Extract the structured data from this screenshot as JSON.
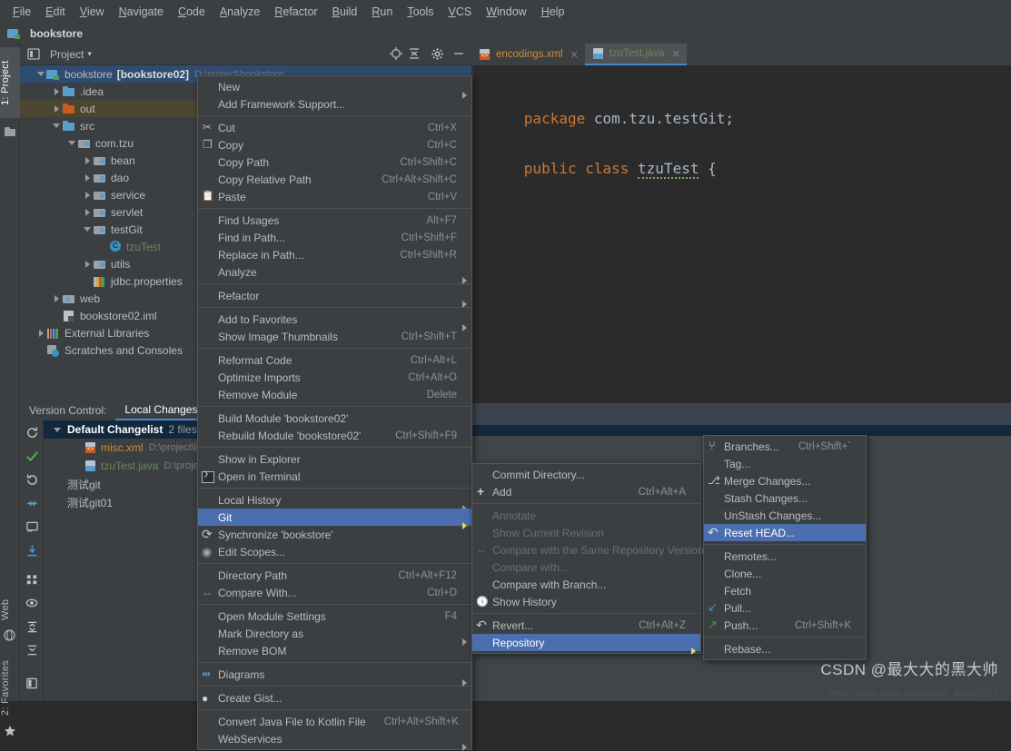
{
  "menubar": {
    "items": [
      "File",
      "Edit",
      "View",
      "Navigate",
      "Code",
      "Analyze",
      "Refactor",
      "Build",
      "Run",
      "Tools",
      "VCS",
      "Window",
      "Help"
    ]
  },
  "title_strip": {
    "project_name": "bookstore"
  },
  "left_rail": {
    "tabs": [
      {
        "label": "1: Project",
        "selected": true
      },
      {
        "label": "Web",
        "selected": false
      },
      {
        "label": "2: Favorites",
        "selected": false
      }
    ]
  },
  "project_panel": {
    "header_label": "Project",
    "dropdown_caret": "▾",
    "tools": [
      "locate-icon",
      "collapse-all-icon",
      "settings-icon",
      "hide-icon"
    ],
    "tree": [
      {
        "indent": 0,
        "arrow": "down",
        "icon": "module-icon",
        "label": "bookstore",
        "bold": "[bookstore02]",
        "path": "D:\\project\\bookstore",
        "selected": true
      },
      {
        "indent": 1,
        "arrow": "right",
        "icon": "folder-blue-icon",
        "label": ".idea"
      },
      {
        "indent": 1,
        "arrow": "right",
        "icon": "folder-orange-icon",
        "label": "out",
        "highlight": true
      },
      {
        "indent": 1,
        "arrow": "down",
        "icon": "folder-blue-icon",
        "label": "src"
      },
      {
        "indent": 2,
        "arrow": "down",
        "icon": "package-icon",
        "label": "com.tzu"
      },
      {
        "indent": 3,
        "arrow": "right",
        "icon": "package-icon",
        "label": "bean"
      },
      {
        "indent": 3,
        "arrow": "right",
        "icon": "package-icon",
        "label": "dao"
      },
      {
        "indent": 3,
        "arrow": "right",
        "icon": "package-icon",
        "label": "service"
      },
      {
        "indent": 3,
        "arrow": "right",
        "icon": "package-icon",
        "label": "servlet"
      },
      {
        "indent": 3,
        "arrow": "down",
        "icon": "package-icon",
        "label": "testGit"
      },
      {
        "indent": 4,
        "arrow": "none",
        "icon": "java-class-icon",
        "label": "tzuTest",
        "color": "green"
      },
      {
        "indent": 3,
        "arrow": "right",
        "icon": "package-icon",
        "label": "utils"
      },
      {
        "indent": 3,
        "arrow": "none",
        "icon": "properties-icon",
        "label": "jdbc.properties"
      },
      {
        "indent": 1,
        "arrow": "right",
        "icon": "web-folder-icon",
        "label": "web"
      },
      {
        "indent": 1,
        "arrow": "none",
        "icon": "iml-icon",
        "label": "bookstore02.iml"
      },
      {
        "indent": 0,
        "arrow": "right",
        "icon": "library-icon",
        "label": "External Libraries"
      },
      {
        "indent": 0,
        "arrow": "none",
        "icon": "scratches-icon",
        "label": "Scratches and Consoles"
      }
    ]
  },
  "editor": {
    "tabs": [
      {
        "label": "encodings.xml",
        "icon": "xml-file-icon",
        "active": false,
        "color": "#cc8b3a"
      },
      {
        "label": "tzuTest.java",
        "icon": "java-file-icon",
        "active": true,
        "color": "#6a8759"
      }
    ],
    "code": {
      "line1_kw": "package",
      "line1_rest": " com.tzu.testGit;",
      "line2_kw": "public class",
      "line2_name": "tzuTest",
      "line2_brace": " {"
    }
  },
  "version_control": {
    "tabs": [
      {
        "label": "Version Control:",
        "selected": false
      },
      {
        "label": "Local Changes",
        "selected": true
      }
    ],
    "rail_icons": [
      "refresh-icon",
      "commit-check-icon",
      "revert-icon",
      "diff-icon",
      "show-diff-icon",
      "update-icon",
      "group-by-icon",
      "preview-eye-icon",
      "expand-all-icon",
      "collapse-all-icon",
      "layout-icon"
    ],
    "rows": [
      {
        "type": "changelist",
        "arrow": "down",
        "label": "Default Changelist",
        "count": "2 files",
        "selected": true
      },
      {
        "type": "file",
        "icon": "xml-file-icon",
        "label": "misc.xml",
        "path": "D:\\project\\bo",
        "color": "#cc8b3a"
      },
      {
        "type": "file",
        "icon": "java-file-icon",
        "label": "tzuTest.java",
        "path": "D:\\project\\",
        "color": "#6a8759"
      },
      {
        "type": "changelist",
        "arrow": "none",
        "label": "测试git"
      },
      {
        "type": "changelist",
        "arrow": "none",
        "label": "测试git01"
      }
    ]
  },
  "context_menu": {
    "items": [
      {
        "label": "New",
        "submenu": true
      },
      {
        "label": "Add Framework Support..."
      },
      {
        "sep": true
      },
      {
        "label": "Cut",
        "shortcut": "Ctrl+X",
        "icon": "cut-icon"
      },
      {
        "label": "Copy",
        "shortcut": "Ctrl+C",
        "icon": "copy-icon"
      },
      {
        "label": "Copy Path",
        "shortcut": "Ctrl+Shift+C"
      },
      {
        "label": "Copy Relative Path",
        "shortcut": "Ctrl+Alt+Shift+C"
      },
      {
        "label": "Paste",
        "shortcut": "Ctrl+V",
        "icon": "paste-icon"
      },
      {
        "sep": true
      },
      {
        "label": "Find Usages",
        "shortcut": "Alt+F7"
      },
      {
        "label": "Find in Path...",
        "shortcut": "Ctrl+Shift+F"
      },
      {
        "label": "Replace in Path...",
        "shortcut": "Ctrl+Shift+R"
      },
      {
        "label": "Analyze",
        "submenu": true
      },
      {
        "sep": true
      },
      {
        "label": "Refactor",
        "submenu": true
      },
      {
        "sep": true
      },
      {
        "label": "Add to Favorites",
        "submenu": true
      },
      {
        "label": "Show Image Thumbnails",
        "shortcut": "Ctrl+Shift+T"
      },
      {
        "sep": true
      },
      {
        "label": "Reformat Code",
        "shortcut": "Ctrl+Alt+L"
      },
      {
        "label": "Optimize Imports",
        "shortcut": "Ctrl+Alt+O"
      },
      {
        "label": "Remove Module",
        "shortcut": "Delete"
      },
      {
        "sep": true
      },
      {
        "label": "Build Module 'bookstore02'"
      },
      {
        "label": "Rebuild Module 'bookstore02'",
        "shortcut": "Ctrl+Shift+F9"
      },
      {
        "sep": true
      },
      {
        "label": "Show in Explorer"
      },
      {
        "label": "Open in Terminal",
        "icon": "terminal-icon"
      },
      {
        "sep": true
      },
      {
        "label": "Local History",
        "submenu": true
      },
      {
        "label": "Git",
        "submenu": true,
        "selected": true
      },
      {
        "label": "Synchronize 'bookstore'",
        "icon": "sync-icon"
      },
      {
        "label": "Edit Scopes...",
        "icon": "scopes-icon"
      },
      {
        "sep": true
      },
      {
        "label": "Directory Path",
        "shortcut": "Ctrl+Alt+F12"
      },
      {
        "label": "Compare With...",
        "shortcut": "Ctrl+D",
        "icon": "compare-icon"
      },
      {
        "sep": true
      },
      {
        "label": "Open Module Settings",
        "shortcut": "F4"
      },
      {
        "label": "Mark Directory as",
        "submenu": true
      },
      {
        "label": "Remove BOM"
      },
      {
        "sep": true
      },
      {
        "label": "Diagrams",
        "submenu": true,
        "icon": "diagrams-icon"
      },
      {
        "sep": true
      },
      {
        "label": "Create Gist...",
        "icon": "gist-icon"
      },
      {
        "sep": true
      },
      {
        "label": "Convert Java File to Kotlin File",
        "shortcut": "Ctrl+Alt+Shift+K"
      },
      {
        "label": "WebServices",
        "submenu": true
      }
    ]
  },
  "git_submenu": {
    "items": [
      {
        "label": "Commit Directory..."
      },
      {
        "label": "Add",
        "shortcut": "Ctrl+Alt+A",
        "icon": "add-icon"
      },
      {
        "sep": true
      },
      {
        "label": "Annotate",
        "disabled": true
      },
      {
        "label": "Show Current Revision",
        "disabled": true
      },
      {
        "label": "Compare with the Same Repository Version",
        "disabled": true,
        "icon": "compare-dim-icon"
      },
      {
        "label": "Compare with...",
        "disabled": true
      },
      {
        "label": "Compare with Branch..."
      },
      {
        "label": "Show History",
        "icon": "history-icon"
      },
      {
        "sep": true
      },
      {
        "label": "Revert...",
        "shortcut": "Ctrl+Alt+Z",
        "icon": "revert-icon"
      },
      {
        "label": "Repository",
        "submenu": true,
        "selected": true
      }
    ]
  },
  "repository_submenu": {
    "items": [
      {
        "label": "Branches...",
        "shortcut": "Ctrl+Shift+`",
        "icon": "branch-icon"
      },
      {
        "label": "Tag..."
      },
      {
        "label": "Merge Changes...",
        "icon": "merge-icon"
      },
      {
        "label": "Stash Changes..."
      },
      {
        "label": "UnStash Changes..."
      },
      {
        "label": "Reset HEAD...",
        "icon": "reset-icon",
        "selected": true
      },
      {
        "sep": true
      },
      {
        "label": "Remotes..."
      },
      {
        "label": "Clone..."
      },
      {
        "label": "Fetch"
      },
      {
        "label": "Pull...",
        "icon": "pull-icon"
      },
      {
        "label": "Push...",
        "shortcut": "Ctrl+Shift+K",
        "icon": "push-icon"
      },
      {
        "sep": true
      },
      {
        "label": "Rebase..."
      }
    ]
  },
  "watermark": {
    "text": "CSDN @最大大的黑大帅",
    "sub": "https://blog.csdn.net/weixin_44982615"
  },
  "colors": {
    "bg_panel": "#3c3f41",
    "bg_editor": "#2b2b2b",
    "selection_blue": "#4b6eaf",
    "tree_selection": "#2f4c70",
    "vcs_selection": "#12283c",
    "accent_tab": "#4a88c7",
    "keyword_orange": "#cc7832",
    "string_green": "#6a8759"
  }
}
